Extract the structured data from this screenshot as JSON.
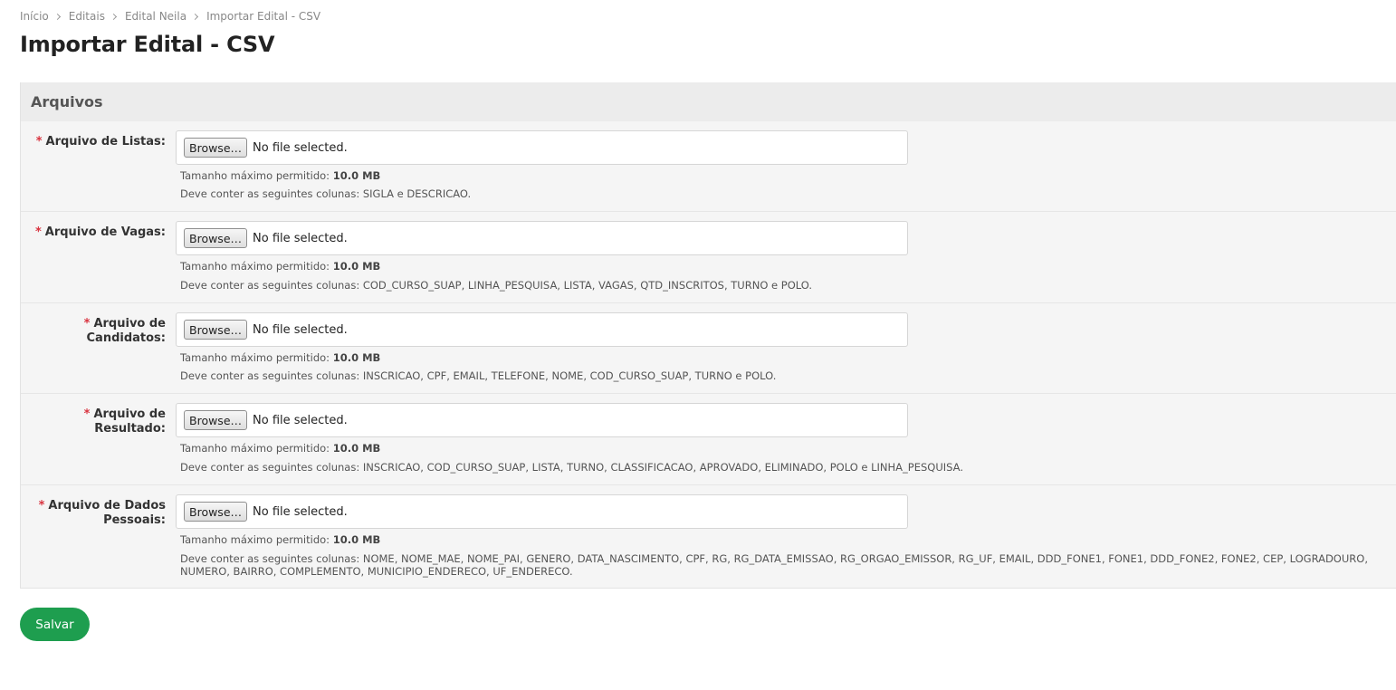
{
  "breadcrumb": {
    "items": [
      "Início",
      "Editais",
      "Edital Neila"
    ],
    "current": "Importar Edital - CSV"
  },
  "page_title": "Importar Edital - CSV",
  "fieldset": {
    "legend": "Arquivos",
    "required_mark": "*",
    "fields": [
      {
        "label_line1": "Arquivo de Listas:",
        "label_line2": "",
        "browse_label": "Browse…",
        "file_status": "No file selected.",
        "max_size_label": "Tamanho máximo permitido:",
        "max_size_value": "10.0 MB",
        "columns_text": "Deve conter as seguintes colunas: SIGLA e DESCRICAO."
      },
      {
        "label_line1": "Arquivo de Vagas:",
        "label_line2": "",
        "browse_label": "Browse…",
        "file_status": "No file selected.",
        "max_size_label": "Tamanho máximo permitido:",
        "max_size_value": "10.0 MB",
        "columns_text": "Deve conter as seguintes colunas: COD_CURSO_SUAP, LINHA_PESQUISA, LISTA, VAGAS, QTD_INSCRITOS, TURNO e POLO."
      },
      {
        "label_line1": "Arquivo de",
        "label_line2": "Candidatos:",
        "browse_label": "Browse…",
        "file_status": "No file selected.",
        "max_size_label": "Tamanho máximo permitido:",
        "max_size_value": "10.0 MB",
        "columns_text": "Deve conter as seguintes colunas: INSCRICAO, CPF, EMAIL, TELEFONE, NOME, COD_CURSO_SUAP, TURNO e POLO."
      },
      {
        "label_line1": "Arquivo de Resultado:",
        "label_line2": "",
        "browse_label": "Browse…",
        "file_status": "No file selected.",
        "max_size_label": "Tamanho máximo permitido:",
        "max_size_value": "10.0 MB",
        "columns_text": "Deve conter as seguintes colunas: INSCRICAO, COD_CURSO_SUAP, LISTA, TURNO, CLASSIFICACAO, APROVADO, ELIMINADO, POLO e LINHA_PESQUISA."
      },
      {
        "label_line1": "Arquivo de Dados",
        "label_line2": "Pessoais:",
        "browse_label": "Browse…",
        "file_status": "No file selected.",
        "max_size_label": "Tamanho máximo permitido:",
        "max_size_value": "10.0 MB",
        "columns_text": "Deve conter as seguintes colunas: NOME, NOME_MAE, NOME_PAI, GENERO, DATA_NASCIMENTO, CPF, RG, RG_DATA_EMISSAO, RG_ORGAO_EMISSOR, RG_UF, EMAIL, DDD_FONE1, FONE1, DDD_FONE2, FONE2, CEP, LOGRADOURO, NUMERO, BAIRRO, COMPLEMENTO, MUNICIPIO_ENDERECO, UF_ENDERECO."
      }
    ]
  },
  "save_label": "Salvar",
  "colors": {
    "save_button": "#1e9e4f",
    "required_mark": "#d9333f",
    "fieldset_bg": "#f5f5f5",
    "legend_bg": "#ececec"
  }
}
